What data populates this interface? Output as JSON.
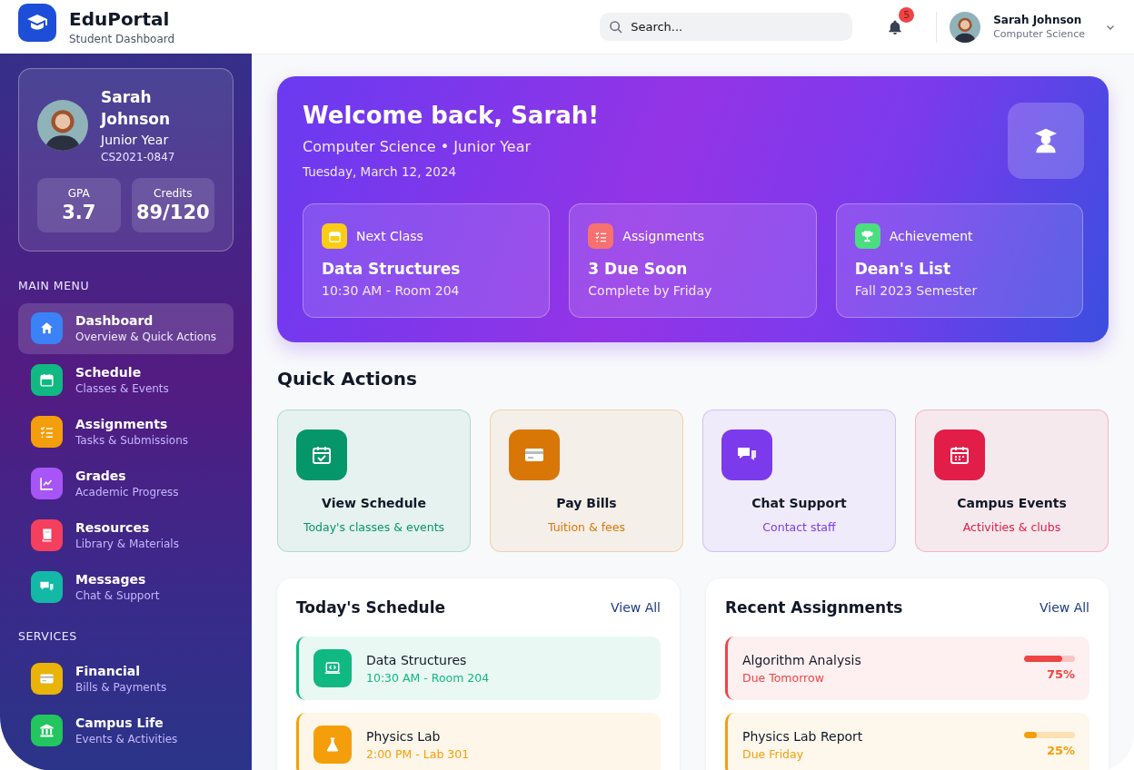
{
  "brand": {
    "title": "EduPortal",
    "subtitle": "Student Dashboard"
  },
  "search": {
    "placeholder": "Search..."
  },
  "notifications": {
    "count": "5"
  },
  "user": {
    "name": "Sarah Johnson",
    "subtitle": "Computer Science"
  },
  "profile": {
    "name": "Sarah Johnson",
    "year": "Junior Year",
    "id": "CS2021-0847",
    "stats": [
      {
        "label": "GPA",
        "value": "3.7"
      },
      {
        "label": "Credits",
        "value": "89/120"
      }
    ]
  },
  "sidebar": [
    {
      "heading": "MAIN MENU",
      "items": [
        {
          "title": "Dashboard",
          "subtitle": "Overview & Quick Actions",
          "kind": "home",
          "color": "#3b82f6",
          "selected": true
        },
        {
          "title": "Schedule",
          "subtitle": "Classes & Events",
          "kind": "calendar",
          "color": "#10b981",
          "selected": false
        },
        {
          "title": "Assignments",
          "subtitle": "Tasks & Submissions",
          "kind": "checklist",
          "color": "#f59e0b",
          "selected": false
        },
        {
          "title": "Grades",
          "subtitle": "Academic Progress",
          "kind": "chart",
          "color": "#a855f7",
          "selected": false
        },
        {
          "title": "Resources",
          "subtitle": "Library & Materials",
          "kind": "book",
          "color": "#f43f5e",
          "selected": false
        },
        {
          "title": "Messages",
          "subtitle": "Chat & Support",
          "kind": "chat",
          "color": "#14b8a6",
          "selected": false
        }
      ]
    },
    {
      "heading": "SERVICES",
      "items": [
        {
          "title": "Financial",
          "subtitle": "Bills & Payments",
          "kind": "card",
          "color": "#eab308",
          "selected": false
        },
        {
          "title": "Campus Life",
          "subtitle": "Events & Activities",
          "kind": "bank",
          "color": "#22c55e",
          "selected": false
        }
      ]
    }
  ],
  "welcome": {
    "title": "Welcome back, Sarah!",
    "subtitle": "Computer Science • Junior Year",
    "date": "Tuesday, March 12, 2024",
    "cards": [
      {
        "label": "Next Class",
        "title": "Data Structures",
        "subtitle": "10:30 AM - Room 204",
        "kind": "calendar",
        "color": "#facc15"
      },
      {
        "label": "Assignments",
        "title": "3 Due Soon",
        "subtitle": "Complete by Friday",
        "kind": "checklist",
        "color": "#f87171"
      },
      {
        "label": "Achievement",
        "title": "Dean's List",
        "subtitle": "Fall 2023 Semester",
        "kind": "trophy",
        "color": "#4ade80"
      }
    ]
  },
  "quick_actions": {
    "heading": "Quick Actions",
    "items": [
      {
        "title": "View Schedule",
        "subtitle": "Today's classes & events",
        "kind": "calendar-check",
        "color": "#059669"
      },
      {
        "title": "Pay Bills",
        "subtitle": "Tuition & fees",
        "kind": "card",
        "color": "#d97706"
      },
      {
        "title": "Chat Support",
        "subtitle": "Contact staff",
        "kind": "chat",
        "color": "#7c3aed"
      },
      {
        "title": "Campus Events",
        "subtitle": "Activities & clubs",
        "kind": "calendar-grid",
        "color": "#e11d48"
      }
    ]
  },
  "schedule": {
    "heading": "Today's Schedule",
    "link": "View All",
    "items": [
      {
        "title": "Data Structures",
        "subtitle": "10:30 AM - Room 204",
        "kind": "laptop",
        "color": "#10b981"
      },
      {
        "title": "Physics Lab",
        "subtitle": "2:00 PM - Lab 301",
        "kind": "flask",
        "color": "#f59e0b"
      }
    ]
  },
  "assignments": {
    "heading": "Recent Assignments",
    "link": "View All",
    "items": [
      {
        "title": "Algorithm Analysis",
        "subtitle": "Due Tomorrow",
        "level": 0.75,
        "reading": "75%",
        "color": "#ef4444"
      },
      {
        "title": "Physics Lab Report",
        "subtitle": "Due Friday",
        "level": 0.25,
        "reading": "25%",
        "color": "#f59e0b"
      }
    ]
  }
}
